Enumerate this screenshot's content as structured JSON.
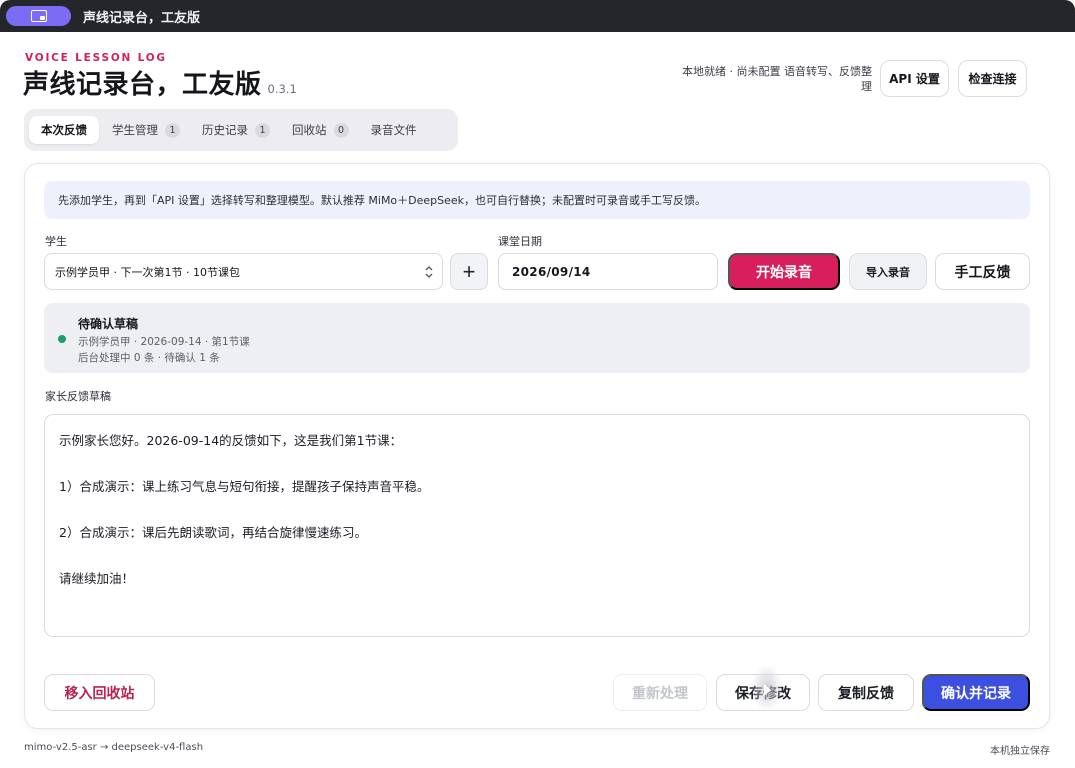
{
  "window": {
    "title": "声线记录台，工友版",
    "app_icon": "id-card-icon"
  },
  "header": {
    "eyebrow": "VOICE LESSON LOG",
    "title": "声线记录台，工友版",
    "version": "0.3.1",
    "status": "本地就绪 · 尚未配置 语音转写、反馈整理",
    "api_settings_label": "API 设置",
    "check_connection_label": "检查连接"
  },
  "tabs": [
    {
      "label": "本次反馈",
      "count": null,
      "active": true
    },
    {
      "label": "学生管理",
      "count": "1"
    },
    {
      "label": "历史记录",
      "count": "1"
    },
    {
      "label": "回收站",
      "count": "0"
    },
    {
      "label": "录音文件",
      "count": null
    }
  ],
  "tip": "先添加学生，再到「API 设置」选择转写和整理模型。默认推荐 MiMo＋DeepSeek，也可自行替换；未配置时可录音或手工写反馈。",
  "form": {
    "student_label": "学生",
    "student_value": "示例学员甲 · 下一次第1节 · 10节课包",
    "add_student_label": "+",
    "date_label": "课堂日期",
    "date_value": "2026/09/14",
    "start_record_label": "开始录音",
    "import_record_label": "导入录音",
    "manual_feedback_label": "手工反馈"
  },
  "draft_status": {
    "title": "待确认草稿",
    "meta": "示例学员甲 · 2026-09-14 · 第1节课",
    "queue": "后台处理中 0 条 · 待确认 1 条",
    "status_color": "#1a9e6a"
  },
  "draft": {
    "label": "家长反馈草稿",
    "lines": [
      "示例家长您好。2026-09-14的反馈如下，这是我们第1节课：",
      "1）合成演示：课上练习气息与短句衔接，提醒孩子保持声音平稳。",
      "2）合成演示：课后先朗读歌词，再结合旋律慢速练习。",
      "请继续加油！"
    ]
  },
  "actions": {
    "trash_label": "移入回收站",
    "reprocess_label": "重新处理",
    "save_label": "保存修改",
    "copy_label": "复制反馈",
    "confirm_label": "确认并记录"
  },
  "footer": {
    "model_chain": "mimo-v2.5-asr → deepseek-v4-flash",
    "storage": "本机独立保存"
  },
  "colors": {
    "accent_record": "#d71f5e",
    "accent_confirm": "#3d4fe0",
    "eyebrow": "#d41f5b"
  }
}
